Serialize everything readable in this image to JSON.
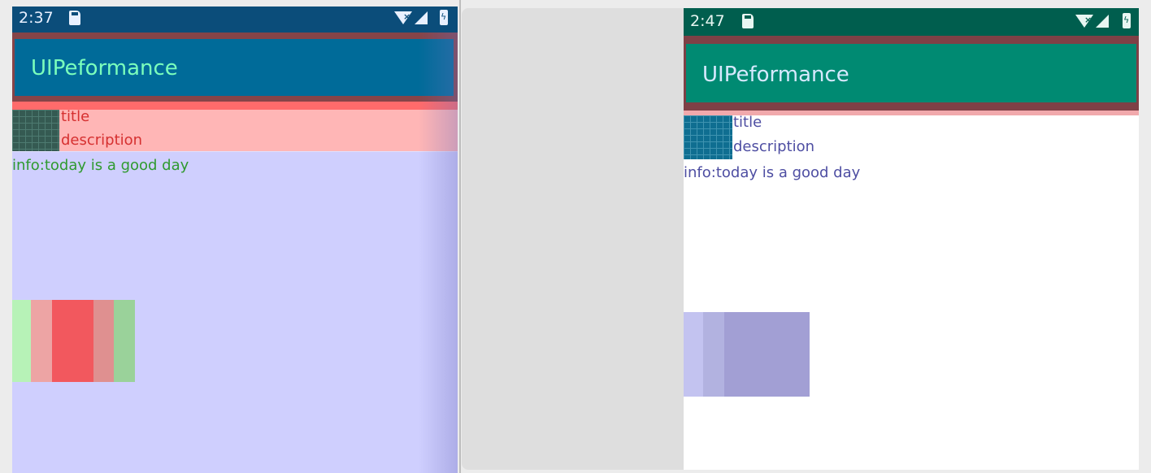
{
  "left_device": {
    "status_time": "2:37",
    "app_title": "UIPeformance",
    "item_title": "title",
    "item_description": "description",
    "info_text": "info:today is a good day",
    "colors": {
      "status_bar": "#0b4d7a",
      "app_bar": "#006b99",
      "app_title_text": "#7bffbc",
      "content_background": "#cfcffe",
      "row_background": "#ffb6b6",
      "row_text": "#d63030",
      "info_text": "#2f9a2f"
    },
    "icons": [
      "sd-card-icon",
      "wifi-icon",
      "cell-signal-icon",
      "battery-icon"
    ]
  },
  "right_device": {
    "status_time": "2:47",
    "app_title": "UIPeformance",
    "item_title": "title",
    "item_description": "description",
    "info_text": "info:today is a good day",
    "colors": {
      "status_bar": "#005e4e",
      "app_bar": "#008a72",
      "app_title_text": "#d6e9ff",
      "content_background": "#ffffff",
      "text": "#4e4ea2"
    },
    "icons": [
      "sd-card-icon",
      "wifi-icon",
      "cell-signal-icon",
      "battery-icon"
    ]
  }
}
